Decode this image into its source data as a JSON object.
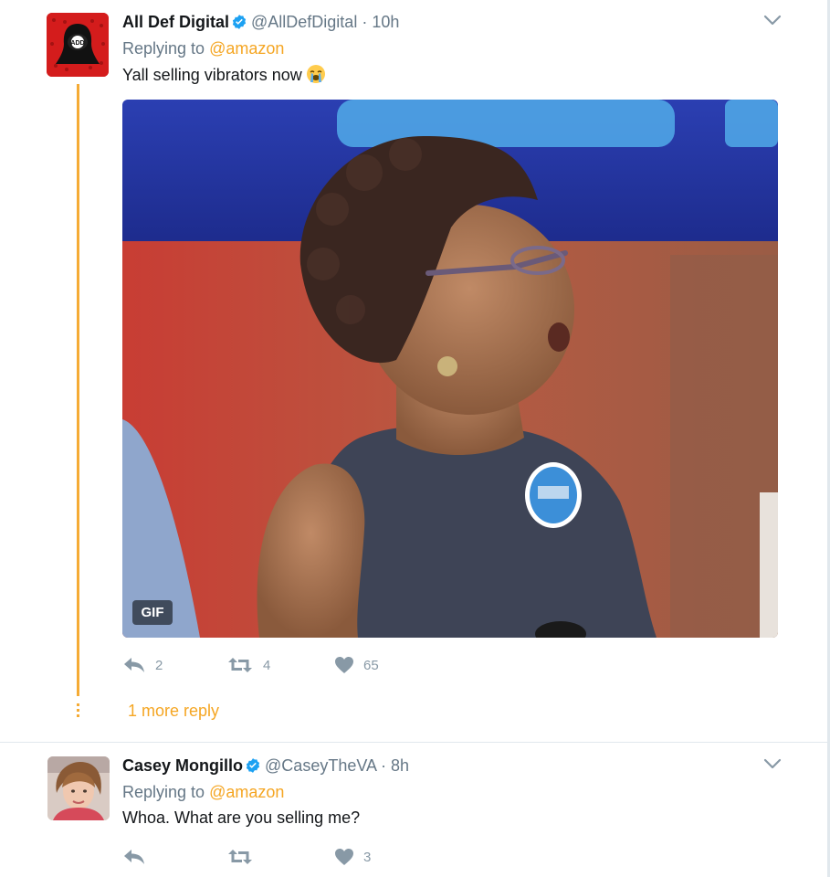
{
  "tweets": [
    {
      "name": "All Def Digital",
      "handle": "@AllDefDigital",
      "time": "· 10h",
      "replying_label": "Replying to",
      "replying_to": "@amazon",
      "text": "Yall selling vibrators now",
      "emoji": "crying-face-emoji",
      "avatar_text": "ADD",
      "media_badge": "GIF",
      "actions": {
        "reply": "2",
        "retweet": "4",
        "like": "65"
      },
      "more_replies": "1 more reply"
    },
    {
      "name": "Casey Mongillo",
      "handle": "@CaseyTheVA",
      "time": "· 8h",
      "replying_label": "Replying to",
      "replying_to": "@amazon",
      "text": "Whoa. What are you selling me?",
      "actions": {
        "reply": "",
        "retweet": "",
        "like": "3"
      }
    }
  ],
  "colors": {
    "accent": "#f5a623",
    "verified": "#1da1f2",
    "muted": "#657786",
    "action": "#8899a6",
    "divider": "#e1e8ed"
  }
}
